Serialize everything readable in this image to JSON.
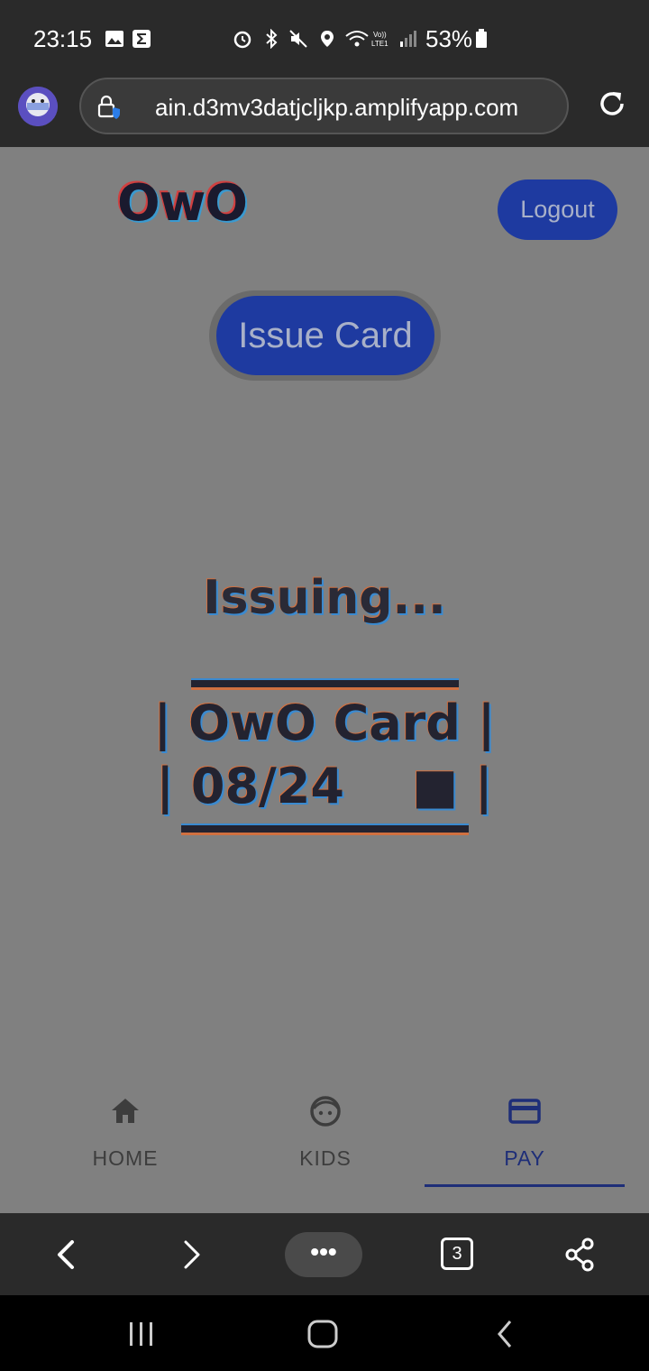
{
  "status_bar": {
    "time": "23:15",
    "battery": "53%",
    "icons": [
      "image-icon",
      "sigma-icon",
      "alarm-icon",
      "bluetooth-icon",
      "mute-icon",
      "location-icon",
      "wifi-icon",
      "volte-icon",
      "signal-icon",
      "battery-icon"
    ]
  },
  "browser": {
    "url": "ain.d3mv3datjcljkp.amplifyapp.com"
  },
  "app": {
    "logo": "OwO",
    "logout_label": "Logout",
    "issue_card_label": "Issue Card",
    "status_text": "Issuing...",
    "card": {
      "top_rule": "______________",
      "line1": "| OwO Card |",
      "line2": "| 08/24    ■ |"
    }
  },
  "bottom_nav": {
    "items": [
      {
        "label": "HOME",
        "icon": "home-icon",
        "active": false
      },
      {
        "label": "KIDS",
        "icon": "face-icon",
        "active": false
      },
      {
        "label": "PAY",
        "icon": "credit-card-icon",
        "active": true
      }
    ]
  },
  "toolbar": {
    "more_label": "•••",
    "tab_count": "3"
  },
  "colors": {
    "accent": "#1e3aa0",
    "page_bg": "#808080",
    "active_nav": "#1e2e78"
  }
}
